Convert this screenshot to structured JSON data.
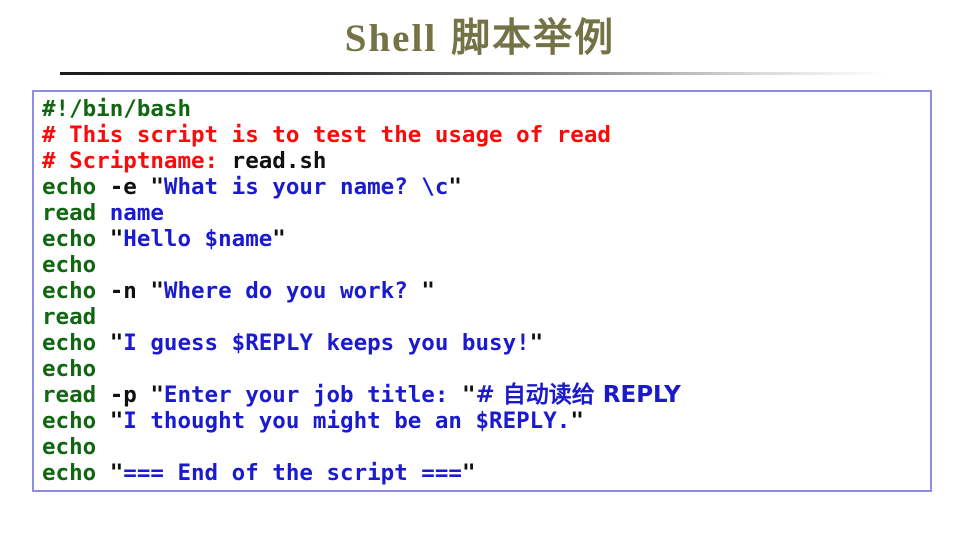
{
  "slide": {
    "title_latin": "Shell",
    "title_cjk": "脚本举例",
    "title_color": "#737346"
  },
  "code_box": {
    "border_color": "#8d8de6",
    "background": "#ffffff",
    "colors": {
      "command_green": "#116611",
      "comment_red": "#fb0a0a",
      "plain_black": "#101010",
      "string_blue": "#1a1ad0",
      "note_navy": "#1a1aca"
    },
    "language": "bash",
    "lines": [
      {
        "n": 1,
        "text": "#!/bin/bash",
        "spans": [
          {
            "t": "#!/bin/bash",
            "c": "cmd"
          }
        ]
      },
      {
        "n": 2,
        "text": "# This script is to test the usage of read",
        "spans": [
          {
            "t": "# This script is to test the usage of read",
            "c": "cmt"
          }
        ]
      },
      {
        "n": 3,
        "text": "# Scriptname: read.sh",
        "spans": [
          {
            "t": "# Scriptname: ",
            "c": "cmt"
          },
          {
            "t": "read.sh",
            "c": "plain"
          }
        ]
      },
      {
        "n": 4,
        "text": "echo -e \"What is your name? \\c\"",
        "spans": [
          {
            "t": "echo",
            "c": "cmd"
          },
          {
            "t": " -e \"",
            "c": "plain"
          },
          {
            "t": "What is your name? \\c",
            "c": "str"
          },
          {
            "t": "\"",
            "c": "plain"
          }
        ]
      },
      {
        "n": 5,
        "text": "read name",
        "spans": [
          {
            "t": "read ",
            "c": "cmd"
          },
          {
            "t": "name",
            "c": "str"
          }
        ]
      },
      {
        "n": 6,
        "text": "echo \"Hello $name\"",
        "spans": [
          {
            "t": "echo",
            "c": "cmd"
          },
          {
            "t": " \"",
            "c": "plain"
          },
          {
            "t": "Hello $name",
            "c": "str"
          },
          {
            "t": "\"",
            "c": "plain"
          }
        ]
      },
      {
        "n": 7,
        "text": "echo",
        "spans": [
          {
            "t": "echo",
            "c": "cmd"
          }
        ]
      },
      {
        "n": 8,
        "text": "echo -n \"Where do you work? \"",
        "spans": [
          {
            "t": "echo",
            "c": "cmd"
          },
          {
            "t": " -n \"",
            "c": "plain"
          },
          {
            "t": "Where do you work? ",
            "c": "str"
          },
          {
            "t": "\"",
            "c": "plain"
          }
        ]
      },
      {
        "n": 9,
        "text": "read",
        "spans": [
          {
            "t": "read",
            "c": "cmd"
          }
        ]
      },
      {
        "n": 10,
        "text": "echo \"I guess $REPLY keeps you busy!\"",
        "spans": [
          {
            "t": "echo",
            "c": "cmd"
          },
          {
            "t": " \"",
            "c": "plain"
          },
          {
            "t": "I guess $REPLY keeps you busy!",
            "c": "str"
          },
          {
            "t": "\"",
            "c": "plain"
          }
        ]
      },
      {
        "n": 11,
        "text": "echo",
        "spans": [
          {
            "t": "echo",
            "c": "cmd"
          }
        ]
      },
      {
        "n": 12,
        "text": "read -p \"Enter your job title: \"# 自动读给 REPLY",
        "spans": [
          {
            "t": "read",
            "c": "cmd"
          },
          {
            "t": " -p \"",
            "c": "plain"
          },
          {
            "t": "Enter your job title: ",
            "c": "str"
          },
          {
            "t": "\"",
            "c": "plain"
          },
          {
            "t": "# 自动读给 REPLY",
            "c": "note"
          }
        ]
      },
      {
        "n": 13,
        "text": "echo \"I thought you might be an $REPLY.\"",
        "spans": [
          {
            "t": "echo",
            "c": "cmd"
          },
          {
            "t": " \"",
            "c": "plain"
          },
          {
            "t": "I thought you might be an $REPLY.",
            "c": "str"
          },
          {
            "t": "\"",
            "c": "plain"
          }
        ]
      },
      {
        "n": 14,
        "text": "echo",
        "spans": [
          {
            "t": "echo",
            "c": "cmd"
          }
        ]
      },
      {
        "n": 15,
        "text": "echo \"=== End of the script ===\"",
        "spans": [
          {
            "t": "echo",
            "c": "cmd"
          },
          {
            "t": " \"",
            "c": "plain"
          },
          {
            "t": "=== End of the script ===",
            "c": "str"
          },
          {
            "t": "\"",
            "c": "plain"
          }
        ]
      }
    ]
  }
}
